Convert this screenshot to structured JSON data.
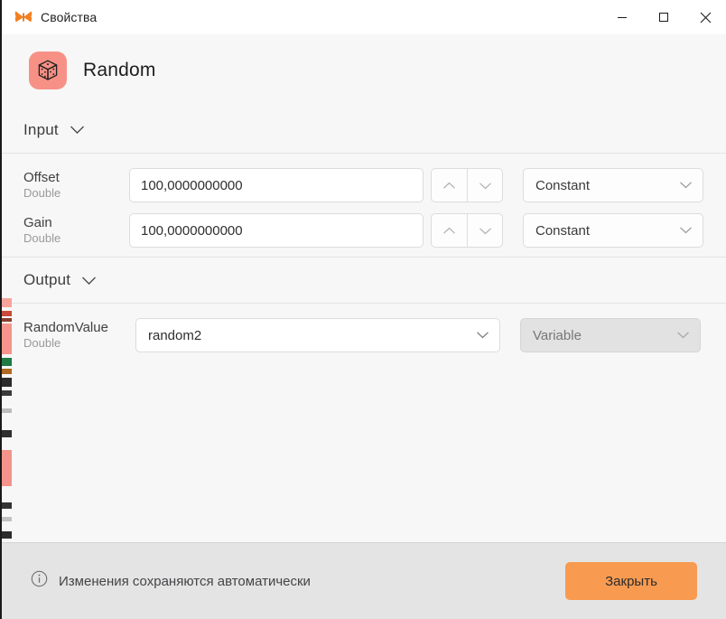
{
  "window": {
    "title": "Свойства",
    "app_icon": "butterfly-icon",
    "controls": {
      "minimize": "minimize-icon",
      "maximize": "maximize-icon",
      "close": "close-icon"
    }
  },
  "node": {
    "icon": "dice-icon",
    "icon_bg": "#f79186",
    "title": "Random"
  },
  "sections": [
    {
      "id": "input",
      "title": "Input",
      "toggle_icon": "chevron-down-icon",
      "rows": [
        {
          "name": "Offset",
          "type": "Double",
          "value": "100,0000000000",
          "placeholder": "",
          "spinner_up": "chevron-up-icon",
          "spinner_down": "chevron-down-icon",
          "mode": "Constant",
          "mode_icon": "chevron-down-icon",
          "mode_disabled": false
        },
        {
          "name": "Gain",
          "type": "Double",
          "value": "100,0000000000",
          "placeholder": "",
          "spinner_up": "chevron-up-icon",
          "spinner_down": "chevron-down-icon",
          "mode": "Constant",
          "mode_icon": "chevron-down-icon",
          "mode_disabled": false
        }
      ]
    },
    {
      "id": "output",
      "title": "Output",
      "toggle_icon": "chevron-down-icon",
      "rows": [
        {
          "name": "RandomValue",
          "type": "Double",
          "value": "random2",
          "select_icon": "chevron-down-icon",
          "mode": "Variable",
          "mode_icon": "chevron-down-icon",
          "mode_disabled": true
        }
      ]
    }
  ],
  "footer": {
    "info_icon": "info-circle-icon",
    "note": "Изменения сохраняются автоматически",
    "close_label": "Закрыть",
    "close_color": "#f89b50"
  }
}
